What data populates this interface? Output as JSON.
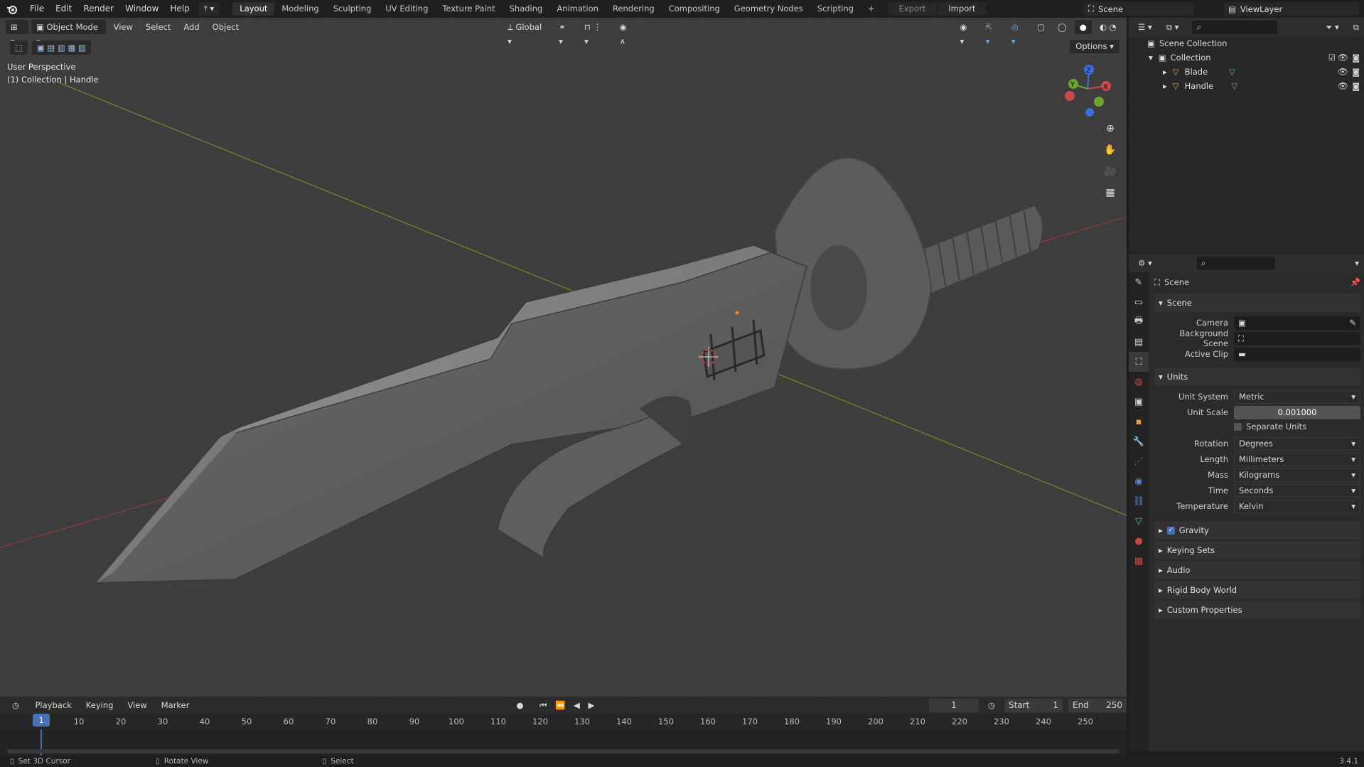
{
  "menu": [
    "File",
    "Edit",
    "Render",
    "Window",
    "Help"
  ],
  "workspaces": [
    "Layout",
    "Modeling",
    "Sculpting",
    "UV Editing",
    "Texture Paint",
    "Shading",
    "Animation",
    "Rendering",
    "Compositing",
    "Geometry Nodes",
    "Scripting"
  ],
  "active_workspace": "Layout",
  "top_buttons": {
    "export": "Export",
    "import": "Import",
    "scene": "Scene",
    "view_layer": "ViewLayer"
  },
  "viewport": {
    "mode": "Object Mode",
    "menus": [
      "View",
      "Select",
      "Add",
      "Object"
    ],
    "orientation": "Global",
    "perspective": "User Perspective",
    "context": "(1) Collection | Handle",
    "options": "Options"
  },
  "outliner": {
    "root": "Scene Collection",
    "collection": "Collection",
    "objects": [
      "Blade",
      "Handle"
    ]
  },
  "properties": {
    "header": "Scene",
    "scene_panel": "Scene",
    "camera_label": "Camera",
    "bg_scene_label": "Background Scene",
    "active_clip_label": "Active Clip",
    "units_panel": "Units",
    "unit_system_label": "Unit System",
    "unit_system": "Metric",
    "unit_scale_label": "Unit Scale",
    "unit_scale": "0.001000",
    "separate_units": "Separate Units",
    "rotation_label": "Rotation",
    "rotation": "Degrees",
    "length_label": "Length",
    "length": "Millimeters",
    "mass_label": "Mass",
    "mass": "Kilograms",
    "time_label": "Time",
    "time": "Seconds",
    "temperature_label": "Temperature",
    "temperature": "Kelvin",
    "collapsed_panels": [
      "Gravity",
      "Keying Sets",
      "Audio",
      "Rigid Body World",
      "Custom Properties"
    ]
  },
  "timeline": {
    "menus": [
      "Playback",
      "Keying",
      "View",
      "Marker"
    ],
    "current_frame": "1",
    "start_label": "Start",
    "start": "1",
    "end_label": "End",
    "end": "250",
    "ticks": [
      "1",
      "10",
      "20",
      "30",
      "40",
      "50",
      "60",
      "70",
      "80",
      "90",
      "100",
      "110",
      "120",
      "130",
      "140",
      "150",
      "160",
      "170",
      "180",
      "190",
      "200",
      "210",
      "220",
      "230",
      "240",
      "250"
    ]
  },
  "status": {
    "left": "Set 3D Cursor",
    "middle": "Rotate View",
    "right": "Select",
    "version": "3.4.1"
  }
}
